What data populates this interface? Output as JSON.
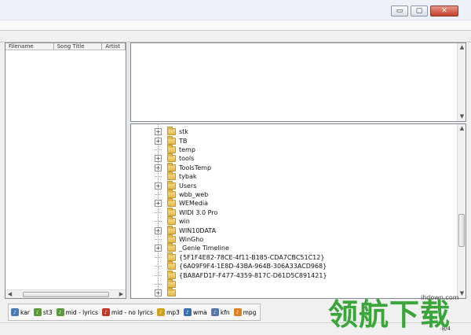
{
  "window": {
    "controls": {
      "minimize": "▭",
      "maximize": "▢",
      "close": "✕"
    }
  },
  "file_list": {
    "columns": [
      "Filename",
      "Song Title",
      "Artist"
    ]
  },
  "folder_tree": {
    "items": [
      {
        "label": "stk",
        "expandable": true
      },
      {
        "label": "TB",
        "expandable": true
      },
      {
        "label": "temp",
        "expandable": false
      },
      {
        "label": "tools",
        "expandable": true
      },
      {
        "label": "ToolsTemp",
        "expandable": true
      },
      {
        "label": "tybak",
        "expandable": false
      },
      {
        "label": "Users",
        "expandable": true
      },
      {
        "label": "wbb_web",
        "expandable": false
      },
      {
        "label": "WEMedia",
        "expandable": true
      },
      {
        "label": "WIDI 3.0 Pro",
        "expandable": false
      },
      {
        "label": "win",
        "expandable": false
      },
      {
        "label": "WIN10DATA",
        "expandable": true
      },
      {
        "label": "WinGho",
        "expandable": false
      },
      {
        "label": "_Genie Timeline",
        "expandable": true
      },
      {
        "label": "{5F1F4E82-78CE-4f11-B185-CDA7CBC51C12}",
        "expandable": false
      },
      {
        "label": "{6A09F9F4-1E8D-43BA-964B-306A33ACD968}",
        "expandable": false
      },
      {
        "label": "{BA8AFD1F-F477-4359-817C-D61D5C891421}",
        "expandable": false
      },
      {
        "label": "",
        "expandable": false
      },
      {
        "label": "",
        "expandable": true
      }
    ]
  },
  "filters": [
    {
      "label": "kar",
      "icon": "karaoke-singer-icon",
      "color": "#4a7ab5"
    },
    {
      "label": "st3",
      "icon": "karaoke-singer-icon",
      "color": "#5a9a3a"
    },
    {
      "label": "mid - lyrics",
      "icon": "karaoke-singer-icon",
      "color": "#5a9a3a"
    },
    {
      "label": "mid - no lyrics",
      "icon": "no-lyrics-icon",
      "color": "#c0392b"
    },
    {
      "label": "mp3",
      "icon": "mp3-icon",
      "color": "#d4a017"
    },
    {
      "label": "wma",
      "icon": "wma-icon",
      "color": "#3a6fb0"
    },
    {
      "label": "kfn",
      "icon": "kfn-icon",
      "color": "#5577aa"
    },
    {
      "label": "mpg",
      "icon": "mpg-icon",
      "color": "#e08020"
    }
  ],
  "status": {
    "right_text": "8/4"
  },
  "watermark": {
    "url": "ihdown.com",
    "text": "领航下载"
  }
}
